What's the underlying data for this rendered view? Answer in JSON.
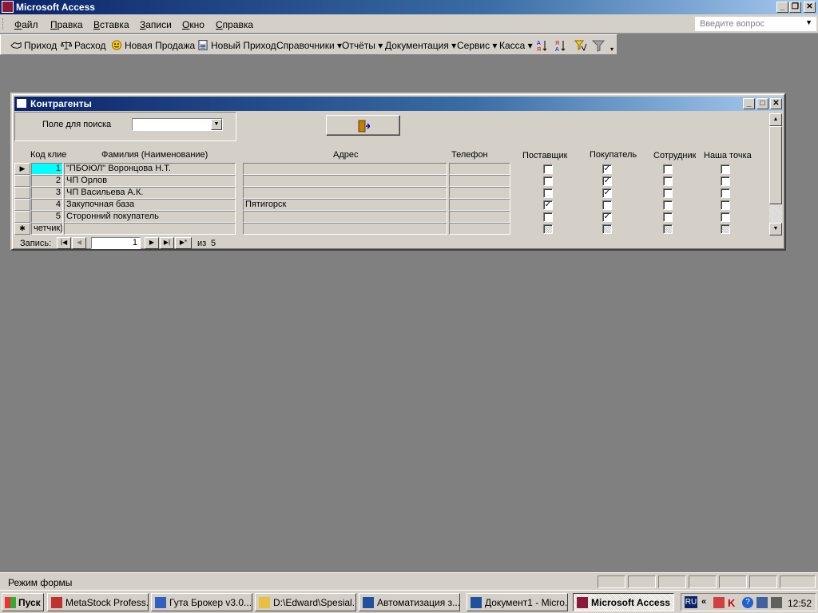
{
  "window": {
    "title": "Microsoft Access"
  },
  "menu": {
    "items": [
      "Файл",
      "Правка",
      "Вставка",
      "Записи",
      "Окно",
      "Справка"
    ],
    "help_placeholder": "Введите вопрос"
  },
  "toolbar": {
    "items": [
      "Приход",
      "Расход",
      "Новая Продажа",
      "Новый Приход",
      "Справочники ▾",
      "Отчёты ▾",
      "Документация ▾",
      "Сервис ▾",
      "Касса ▾"
    ]
  },
  "form": {
    "title": "Контрагенты",
    "search_label": "Поле для поиска",
    "search_value": "",
    "columns": [
      "Код клие",
      "Фамилия (Наименование)",
      "Адрес",
      "Телефон",
      "Поставщик",
      "Покупатель",
      "Сотрудник",
      "Наша точка"
    ],
    "rows": [
      {
        "id": "1",
        "name": "\"ПБОЮЛ\" Воронцова Н.Т.",
        "address": "",
        "phone": "",
        "supplier": false,
        "buyer": true,
        "employee": false,
        "our_point": false
      },
      {
        "id": "2",
        "name": "ЧП Орлов",
        "address": "",
        "phone": "",
        "supplier": false,
        "buyer": true,
        "employee": false,
        "our_point": false
      },
      {
        "id": "3",
        "name": "ЧП Васильева А.К.",
        "address": "",
        "phone": "",
        "supplier": false,
        "buyer": true,
        "employee": false,
        "our_point": false
      },
      {
        "id": "4",
        "name": "Закупочная база",
        "address": "Пятигорск",
        "phone": "",
        "supplier": true,
        "buyer": false,
        "employee": false,
        "our_point": false
      },
      {
        "id": "5",
        "name": "Сторонний покупатель",
        "address": "",
        "phone": "",
        "supplier": false,
        "buyer": true,
        "employee": false,
        "our_point": false
      }
    ],
    "new_row_id": "четчик)",
    "nav": {
      "label": "Запись:",
      "current": "1",
      "of_label": "из",
      "total": "5"
    }
  },
  "status": {
    "text": "Режим формы"
  },
  "taskbar": {
    "start": "Пуск",
    "tasks": [
      "MetaStock Profess...",
      "Гута Брокер v3.0....",
      "D:\\Edward\\Spesial...",
      "Автоматизация з...",
      "Документ1 - Micro...",
      "Microsoft Access"
    ],
    "lang": "RU",
    "time": "12:52"
  }
}
